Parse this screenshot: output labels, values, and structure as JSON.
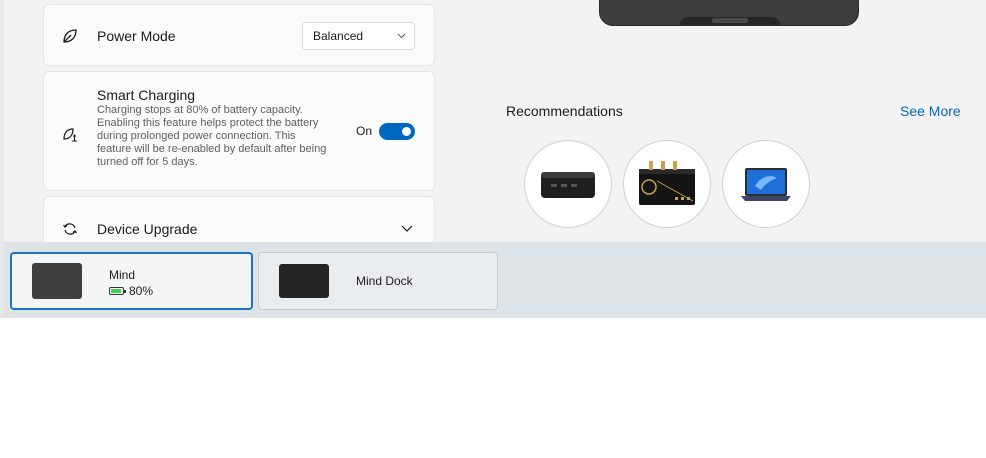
{
  "settings": {
    "power_mode": {
      "title": "Power Mode",
      "icon": "leaf-icon",
      "selected": "Balanced"
    },
    "smart_charging": {
      "title": "Smart Charging",
      "icon": "eco-charging-icon",
      "description": "Charging stops at 80% of battery capacity. Enabling this feature helps protect the battery during prolonged power connection. This feature will be re-enabled by default after being turned off for 5 days.",
      "toggle_label": "On",
      "enabled": true
    },
    "device_upgrade": {
      "title": "Device Upgrade",
      "icon": "sync-icon"
    }
  },
  "recommendations": {
    "title": "Recommendations",
    "see_more": "See More",
    "items": [
      "dock-product",
      "sound-card-product",
      "tablet-laptop-product"
    ]
  },
  "devices": [
    {
      "name": "Mind",
      "battery": "80%",
      "battery_level": 0.8,
      "active": true
    },
    {
      "name": "Mind Dock",
      "active": false
    }
  ],
  "colors": {
    "accent": "#0067c0",
    "battery": "#3fd14a"
  }
}
